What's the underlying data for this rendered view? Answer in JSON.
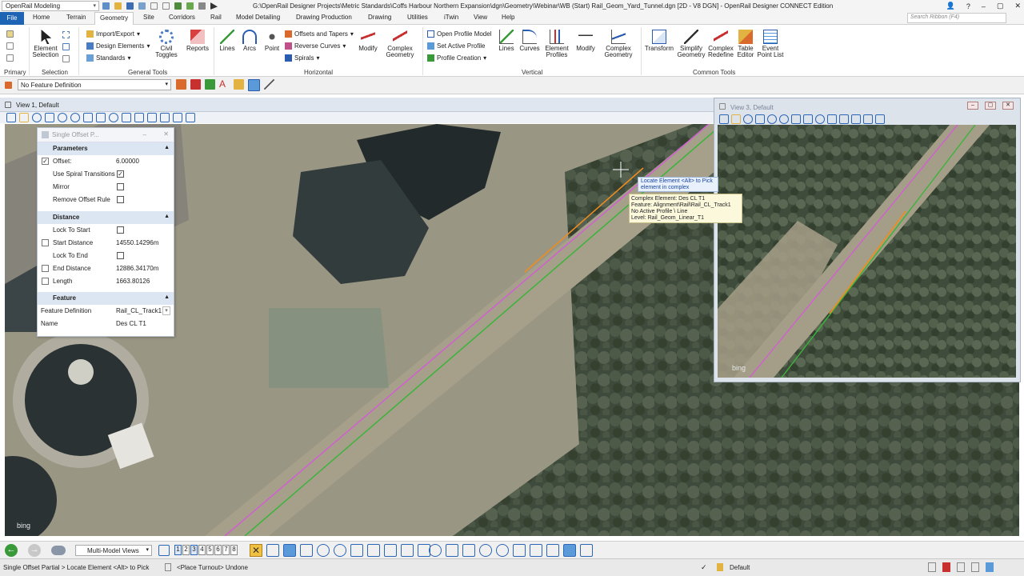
{
  "app": {
    "workspace": "OpenRail Modeling",
    "window_title": "G:\\OpenRail Designer Projects\\Metric Standards\\Coffs Harbour Northern Expansion\\dgn\\Geometry\\Webinar\\WB (Start) Rail_Geom_Yard_Tunnel.dgn [2D - V8 DGN] - OpenRail Designer CONNECT Edition"
  },
  "ribbon": {
    "tabs": [
      "File",
      "Home",
      "Terrain",
      "Geometry",
      "Site",
      "Corridors",
      "Rail",
      "Model Detailing",
      "Drawing Production",
      "Drawing",
      "Utilities",
      "iTwin",
      "View",
      "Help"
    ],
    "active_tab": "Geometry",
    "search_placeholder": "Search Ribbon (F4)",
    "groups": {
      "primary": "Primary",
      "selection": "Selection",
      "general_tools": "General Tools",
      "horizontal": "Horizontal",
      "vertical": "Vertical",
      "common_tools": "Common Tools"
    },
    "buttons": {
      "element_selection": "Element Selection",
      "import_export": "Import/Export",
      "design_elements": "Design Elements",
      "standards": "Standards",
      "civil_toggles": "Civil Toggles",
      "reports": "Reports",
      "lines": "Lines",
      "arcs": "Arcs",
      "point": "Point",
      "offsets_tapers": "Offsets and Tapers",
      "reverse_curves": "Reverse Curves",
      "spirals": "Spirals",
      "modify": "Modify",
      "complex_geometry": "Complex Geometry",
      "open_profile_model": "Open Profile Model",
      "set_active_profile": "Set Active Profile",
      "profile_creation": "Profile Creation",
      "v_lines": "Lines",
      "v_curves": "Curves",
      "element_profiles": "Element Profiles",
      "v_modify": "Modify",
      "v_complex_geometry": "Complex Geometry",
      "transform": "Transform",
      "simplify_geometry": "Simplify Geometry",
      "complex_redefine": "Complex Redefine",
      "table_editor": "Table Editor",
      "event_point_list": "Event Point List"
    }
  },
  "feature_bar": {
    "feature_definition": "No Feature Definition"
  },
  "view1": {
    "title": "View 1, Default",
    "bing": "bing"
  },
  "view3": {
    "title": "View 3, Default",
    "bing": "bing"
  },
  "panel": {
    "title": "Single Offset P...",
    "sections": {
      "parameters": "Parameters",
      "distance": "Distance",
      "feature": "Feature"
    },
    "offset": {
      "label": "Offset:",
      "value": "6.00000"
    },
    "use_spiral": {
      "label": "Use Spiral Transitions",
      "checked": true
    },
    "mirror": {
      "label": "Mirror",
      "checked": false
    },
    "remove_offset_rule": {
      "label": "Remove Offset Rule",
      "checked": false
    },
    "lock_to_start": {
      "label": "Lock To Start",
      "checked": false
    },
    "start_distance": {
      "label": "Start Distance",
      "value": "14550.14296m"
    },
    "lock_to_end": {
      "label": "Lock To End",
      "checked": false
    },
    "end_distance": {
      "label": "End Distance",
      "value": "12886.34170m"
    },
    "length": {
      "label": "Length",
      "value": "1663.80126"
    },
    "feature_definition": {
      "label": "Feature Definition",
      "value": "Rail_CL_Track1"
    },
    "name": {
      "label": "Name",
      "value": "Des CL T1"
    }
  },
  "tooltip": {
    "locate": "Locate Element <Alt> to Pick element in complex",
    "lines": [
      "Complex Element: Des CL T1",
      "Feature: Alignment\\Rail\\Rail_CL_Track1",
      "No Active Profile \\ Line",
      "Level: Rail_Geom_Linear_T1"
    ]
  },
  "bottom_toolbar": {
    "view_mode": "Multi-Model Views",
    "view_numbers": [
      "1",
      "2",
      "3",
      "4",
      "5",
      "6",
      "7",
      "8"
    ]
  },
  "status": {
    "prompt": "Single Offset Partial > Locate Element <Alt> to Pick",
    "message": "<Place Turnout> Undone",
    "level": "Default"
  },
  "colors": {
    "accent": "#1e64b4",
    "alignment_magenta": "#d060d0",
    "alignment_green": "#3bb43b",
    "offset_orange": "#f08c1e"
  }
}
